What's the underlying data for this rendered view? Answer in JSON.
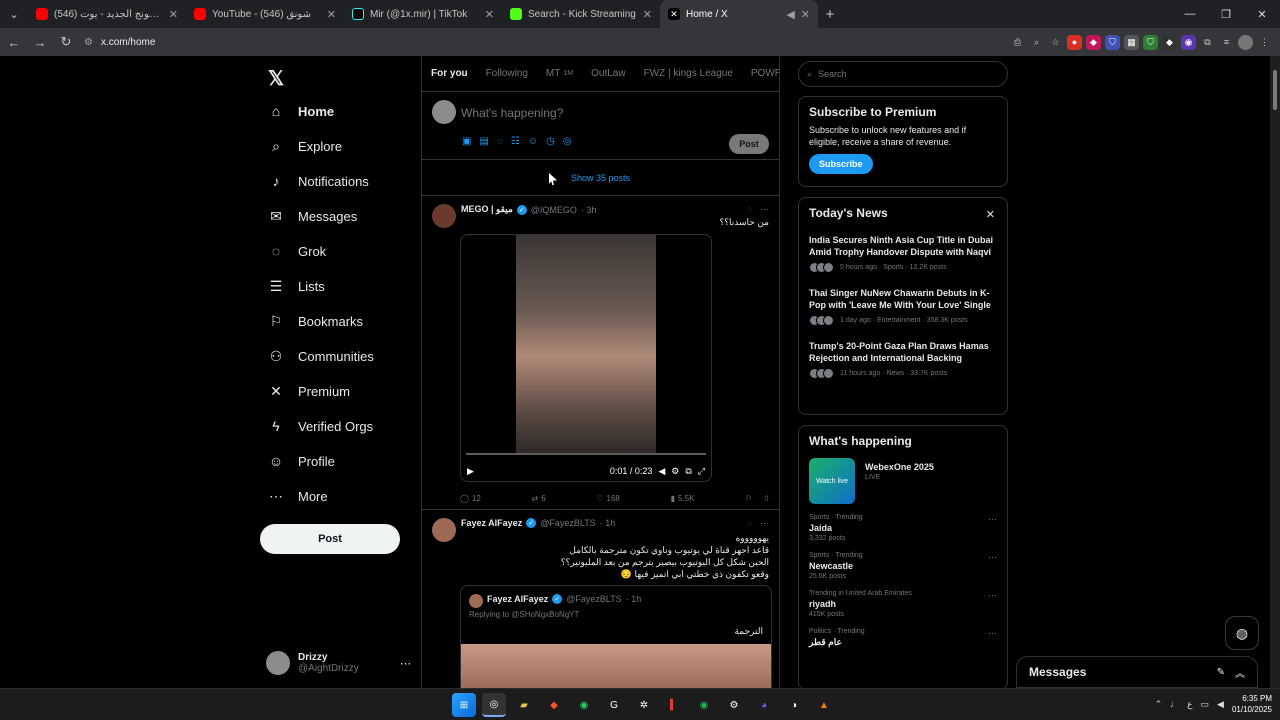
{
  "browser": {
    "tabs": [
      {
        "title": "(546) اعلان سامسونج الجديد - يوت",
        "color": "#ff0000"
      },
      {
        "title": "YouTube - (546) شونق",
        "color": "#ff0000"
      },
      {
        "title": "Mir (@1x.mir) | TikTok",
        "color": "#ffffff"
      },
      {
        "title": "Search - Kick Streaming",
        "color": "#53fc18"
      },
      {
        "title": "Home / X",
        "color": "#ffffff"
      }
    ],
    "url": "x.com/home"
  },
  "sidebar": {
    "items": [
      {
        "label": "Home",
        "icon": "home-icon",
        "glyph": "⌂"
      },
      {
        "label": "Explore",
        "icon": "search-icon",
        "glyph": "⌕"
      },
      {
        "label": "Notifications",
        "icon": "bell-icon",
        "glyph": "♪"
      },
      {
        "label": "Messages",
        "icon": "mail-icon",
        "glyph": "✉"
      },
      {
        "label": "Grok",
        "icon": "grok-icon",
        "glyph": "◌"
      },
      {
        "label": "Lists",
        "icon": "list-icon",
        "glyph": "☰"
      },
      {
        "label": "Bookmarks",
        "icon": "bookmark-icon",
        "glyph": "⚐"
      },
      {
        "label": "Communities",
        "icon": "people-icon",
        "glyph": "⚇"
      },
      {
        "label": "Premium",
        "icon": "x-icon",
        "glyph": "✕"
      },
      {
        "label": "Verified Orgs",
        "icon": "lightning-icon",
        "glyph": "ϟ"
      },
      {
        "label": "Profile",
        "icon": "user-icon",
        "glyph": "☺"
      },
      {
        "label": "More",
        "icon": "more-icon",
        "glyph": "⋯"
      }
    ],
    "post_label": "Post",
    "account": {
      "name": "Drizzy",
      "handle": "@AightDrizzy"
    }
  },
  "feed": {
    "tabs": [
      {
        "label": "For you",
        "sub": ""
      },
      {
        "label": "Following",
        "sub": ""
      },
      {
        "label": "MT",
        "sub": "1M"
      },
      {
        "label": "OutLaw",
        "sub": ""
      },
      {
        "label": "FWZ | kings League",
        "sub": ""
      },
      {
        "label": "POWR | ور",
        "sub": ""
      }
    ],
    "composer_placeholder": "What's happening?",
    "composer_post": "Post",
    "show_posts": "Show 35 posts",
    "tweet1": {
      "name": "MEGO | ميقو",
      "handle": "@IQMEGO",
      "time": "· 3h",
      "text": "من حاسدنا؟؟",
      "video_time": "0:01 / 0:23",
      "stats": {
        "replies": "12",
        "reposts": "6",
        "likes": "168",
        "views": "5.5K"
      }
    },
    "tweet2": {
      "name": "Fayez AlFayez",
      "handle": "@FayezBLTS",
      "time": "· 1h",
      "lines": [
        "يهوووووه",
        "قاعد اجهز قناة لي يوتيوب وناوي تكون مترجمة بالكامل",
        "الحين شكل كل اليوتيوب بيصير يترجم من بعد المليونير؟؟",
        "وقعو تكفون ذي خطتي ابي اتميز فيها 😔"
      ],
      "quote": {
        "name": "Fayez AlFayez",
        "handle": "@FayezBLTS",
        "time": "· 1h",
        "reply": "Replying to @SHoNgxBoNgYT",
        "text": "الترجمة"
      }
    }
  },
  "right": {
    "search_placeholder": "Search",
    "premium": {
      "title": "Subscribe to Premium",
      "text": "Subscribe to unlock new features and if eligible, receive a share of revenue.",
      "button": "Subscribe"
    },
    "news": {
      "title": "Today's News",
      "items": [
        {
          "headline": "India Secures Ninth Asia Cup Title in Dubai Amid Trophy Handover Dispute with Naqvi",
          "meta": "5 hours ago · Sports · 12.2K posts"
        },
        {
          "headline": "Thai Singer NuNew Chawarin Debuts in K-Pop with 'Leave Me With Your Love' Single",
          "meta": "1 day ago · Entertainment · 358.3K posts"
        },
        {
          "headline": "Trump's 20-Point Gaza Plan Draws Hamas Rejection and International Backing",
          "meta": "11 hours ago · News · 33.7K posts"
        }
      ]
    },
    "happening": {
      "title": "What's happening",
      "event": {
        "title": "WebexOne 2025",
        "label": "LIVE",
        "thumb": "Watch live"
      },
      "trends": [
        {
          "category": "Sports · Trending",
          "name": "Jaida",
          "posts": "3,332 posts"
        },
        {
          "category": "Sports · Trending",
          "name": "Newcastle",
          "posts": "25.6K posts"
        },
        {
          "category": "Trending in United Arab Emirates",
          "name": "riyadh",
          "posts": "415K posts"
        },
        {
          "category": "Politics · Trending",
          "name": "عام قطر",
          "posts": ""
        }
      ]
    }
  },
  "messages": {
    "title": "Messages"
  },
  "taskbar": {
    "time": "6:35 PM",
    "date": "01/10/2025",
    "lang": "ع"
  }
}
